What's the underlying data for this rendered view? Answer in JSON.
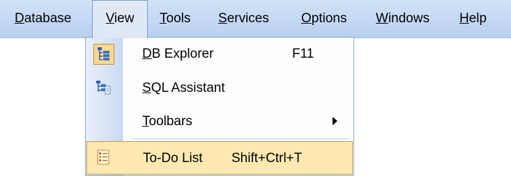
{
  "menubar": {
    "items": [
      {
        "label_pre": "",
        "label_acc": "D",
        "label_post": "atabase"
      },
      {
        "label_pre": "",
        "label_acc": "V",
        "label_post": "iew"
      },
      {
        "label_pre": "",
        "label_acc": "T",
        "label_post": "ools"
      },
      {
        "label_pre": "",
        "label_acc": "S",
        "label_post": "ervices"
      },
      {
        "label_pre": "",
        "label_acc": "O",
        "label_post": "ptions"
      },
      {
        "label_pre": "",
        "label_acc": "W",
        "label_post": "indows"
      },
      {
        "label_pre": "",
        "label_acc": "H",
        "label_post": "elp"
      }
    ]
  },
  "view_menu": {
    "items": [
      {
        "label_acc": "D",
        "label_post": "B Explorer",
        "shortcut": "F11",
        "icon": "db-explorer-icon",
        "checked": true
      },
      {
        "label_acc": "S",
        "label_post": "QL Assistant",
        "shortcut": "",
        "icon": "sql-assistant-icon",
        "checked": false
      },
      {
        "label_acc": "T",
        "label_post": "oolbars",
        "shortcut": "",
        "icon": "",
        "submenu": true
      },
      {
        "label_acc": "",
        "label_post": "To-Do List",
        "shortcut": "Shift+Ctrl+T",
        "icon": "todo-list-icon",
        "highlighted": true
      }
    ]
  },
  "colors": {
    "menubar_bg": "#c5d9f4",
    "highlight_bg": "#fde9b1",
    "checked_bg": "#fbd891"
  }
}
